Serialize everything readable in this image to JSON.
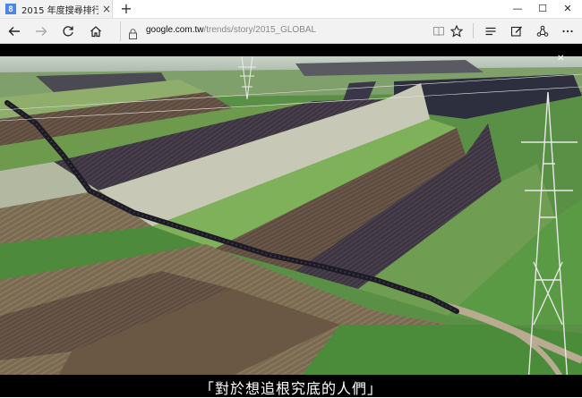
{
  "browser": {
    "tab": {
      "favicon_letter": "8",
      "title": "2015 年度搜尋排行!",
      "close_glyph": "×"
    },
    "new_tab_glyph": "+",
    "window_controls": {
      "minimize": "—",
      "maximize": "☐",
      "close": "✕"
    },
    "address": {
      "domain": "google.com.tw",
      "path": "/trends/story/2015_GLOBAL"
    },
    "icons": [
      "back-arrow",
      "forward-arrow",
      "refresh",
      "home",
      "lock",
      "reading-view",
      "favorite-star",
      "hub",
      "web-note",
      "share",
      "more"
    ]
  },
  "video": {
    "subtitle": "「對於想追根究底的人們」",
    "colors": {
      "brown_field": "#5a4a3e",
      "green_field": "#4e8a3e",
      "path": "#b3a48e",
      "crowd": "#1a1a22"
    }
  }
}
